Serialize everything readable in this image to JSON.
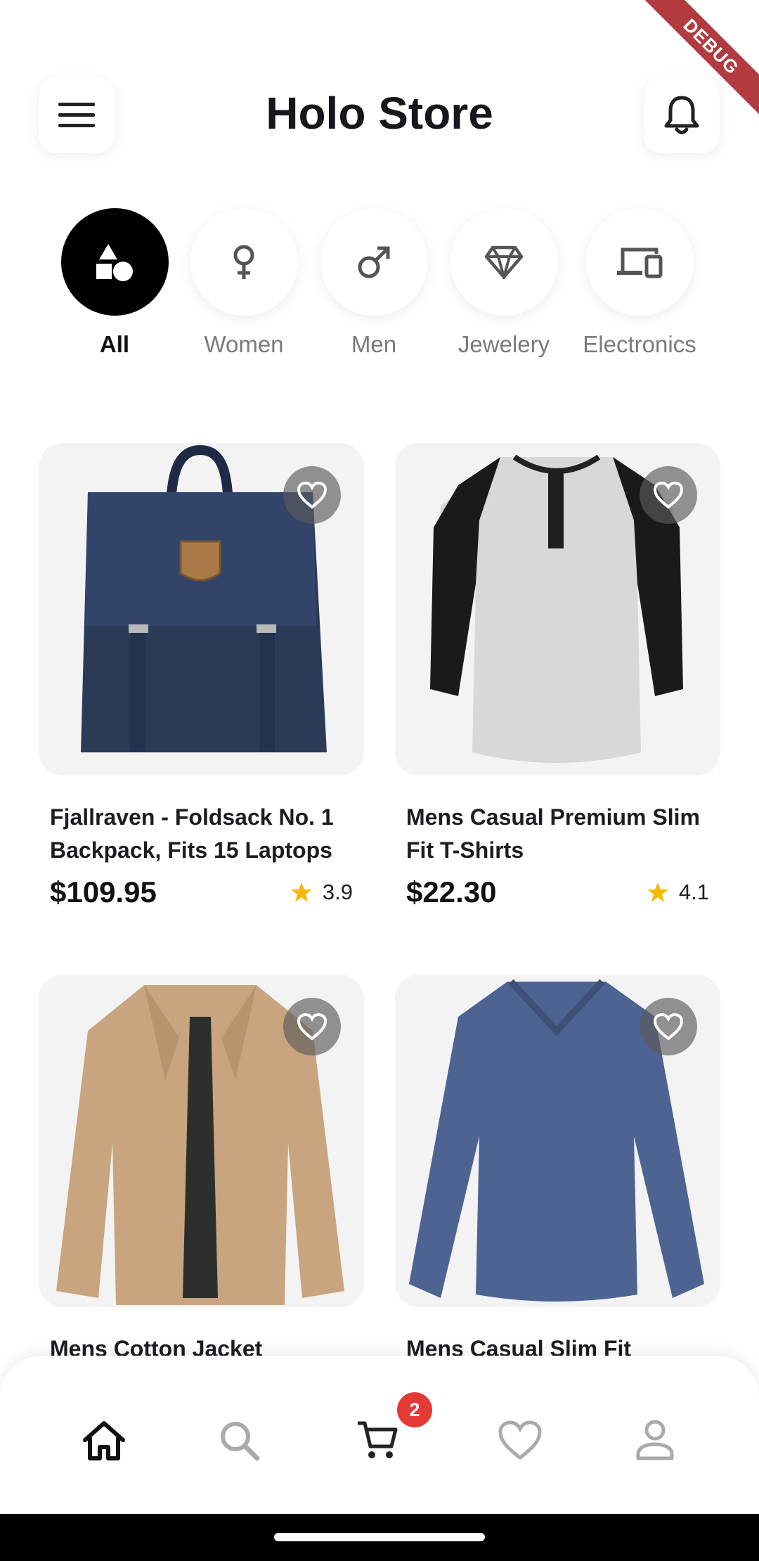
{
  "header": {
    "title": "Holo Store"
  },
  "debug_banner": "DEBUG",
  "categories": [
    {
      "label": "All",
      "icon": "shapes-icon",
      "active": true
    },
    {
      "label": "Women",
      "icon": "female-icon",
      "active": false
    },
    {
      "label": "Men",
      "icon": "male-icon",
      "active": false
    },
    {
      "label": "Jewelery",
      "icon": "diamond-icon",
      "active": false
    },
    {
      "label": "Electronics",
      "icon": "devices-icon",
      "active": false
    }
  ],
  "products": [
    {
      "name": "Fjallraven - Foldsack No. 1 Backpack, Fits 15 Laptops",
      "price": "$109.95",
      "rating": "3.9",
      "image": "backpack"
    },
    {
      "name": "Mens Casual Premium Slim Fit T-Shirts",
      "price": "$22.30",
      "rating": "4.1",
      "image": "raglan-tshirt"
    },
    {
      "name": "Mens Cotton Jacket",
      "image": "jacket"
    },
    {
      "name": "Mens Casual Slim Fit",
      "image": "long-sleeve-tee"
    }
  ],
  "bottom_nav": [
    {
      "name": "home",
      "icon": "home-icon",
      "active": true
    },
    {
      "name": "search",
      "icon": "search-icon"
    },
    {
      "name": "cart",
      "icon": "cart-icon",
      "badge": "2"
    },
    {
      "name": "favorites",
      "icon": "heart-icon"
    },
    {
      "name": "profile",
      "icon": "person-icon"
    }
  ],
  "colors": {
    "accent": "#000000",
    "star": "#f6b800",
    "badge": "#e53935",
    "card_bg": "#f3f3f3"
  }
}
